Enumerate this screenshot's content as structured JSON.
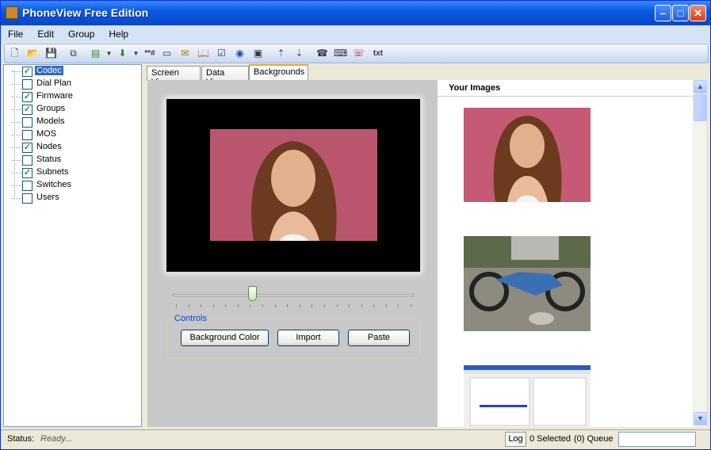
{
  "window": {
    "title": "PhoneView Free Edition",
    "minimize": "–",
    "maximize": "□",
    "close": "✕"
  },
  "menu": [
    "File",
    "Edit",
    "Group",
    "Help"
  ],
  "toolbar": {
    "icons": [
      "new-icon",
      "open-icon",
      "save-icon",
      "copy-icon",
      "export-icon",
      "import-icon",
      "password-icon",
      "blank-icon",
      "mail-icon",
      "book-icon",
      "checklist-icon",
      "globe-icon",
      "film-icon",
      "upload-icon",
      "download-icon",
      "phone-list-icon",
      "keyboard-icon",
      "sos-phone-icon",
      "txt-icon"
    ],
    "txt_label": "txt",
    "pw_label": "**#"
  },
  "tree": {
    "items": [
      {
        "label": "Codec",
        "checked": true,
        "selected": true
      },
      {
        "label": "Dial Plan",
        "checked": false
      },
      {
        "label": "Firmware",
        "checked": true
      },
      {
        "label": "Groups",
        "checked": true
      },
      {
        "label": "Models",
        "checked": false
      },
      {
        "label": "MOS",
        "checked": false
      },
      {
        "label": "Nodes",
        "checked": true
      },
      {
        "label": "Status",
        "checked": false
      },
      {
        "label": "Subnets",
        "checked": true
      },
      {
        "label": "Switches",
        "checked": false
      },
      {
        "label": "Users",
        "checked": false
      }
    ]
  },
  "tabs": [
    {
      "label": "Screen View",
      "active": false
    },
    {
      "label": "Data View",
      "active": false
    },
    {
      "label": "Backgrounds",
      "active": true
    }
  ],
  "backgrounds": {
    "slider_fraction": 0.33,
    "controls_label": "Controls",
    "buttons": {
      "background_color": "Background Color",
      "import": "Import",
      "paste": "Paste"
    }
  },
  "gallery": {
    "header": "Your Images"
  },
  "status": {
    "label": "Status:",
    "value": "Ready...",
    "log": "Log",
    "selected": "0 Selected",
    "queue": "(0) Queue"
  }
}
